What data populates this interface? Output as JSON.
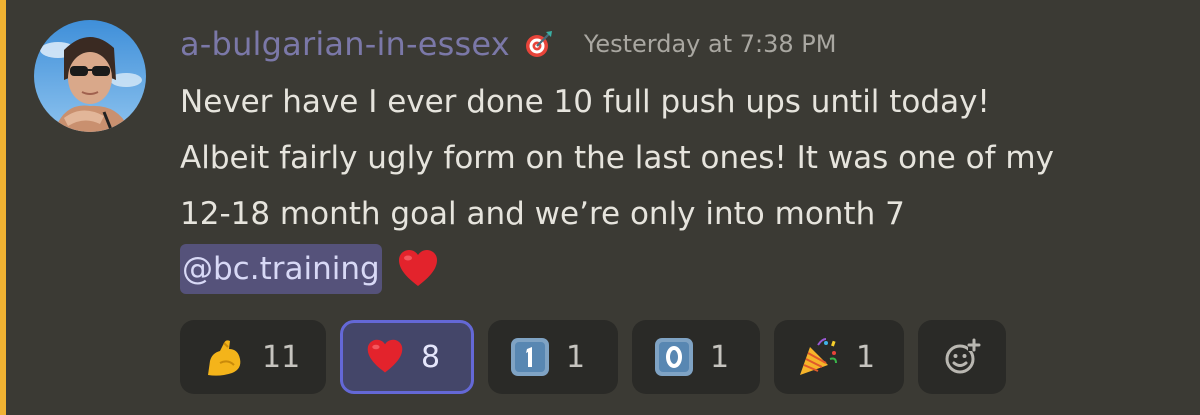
{
  "message": {
    "username": "a-bulgarian-in-essex",
    "badge_icon": "dart-target-icon",
    "timestamp": "Yesterday at 7:38 PM",
    "lines": [
      "Never have I ever done 10 full push ups until today!",
      "Albeit fairly ugly form on the last ones! It was one of my",
      "12-18 month goal and we’re only into month 7"
    ],
    "mention": "@bc.training",
    "trailing_emoji": "red-heart-emoji"
  },
  "reactions": [
    {
      "emoji": "flexed-biceps-emoji",
      "count": "11",
      "active": false
    },
    {
      "emoji": "red-heart-emoji",
      "count": "8",
      "active": true
    },
    {
      "emoji": "keycap-1-emoji",
      "count": "1",
      "active": false
    },
    {
      "emoji": "keycap-0-emoji",
      "count": "1",
      "active": false
    },
    {
      "emoji": "party-popper-emoji",
      "count": "1",
      "active": false
    }
  ],
  "add_reaction_icon": "add-reaction-icon",
  "colors": {
    "background": "#3b3a34",
    "accent_bar": "#f0b232",
    "username": "#7b78a8",
    "mention_bg": "#55527a",
    "reaction_bg": "#2a2a27",
    "reaction_active_border": "#6468d6"
  }
}
